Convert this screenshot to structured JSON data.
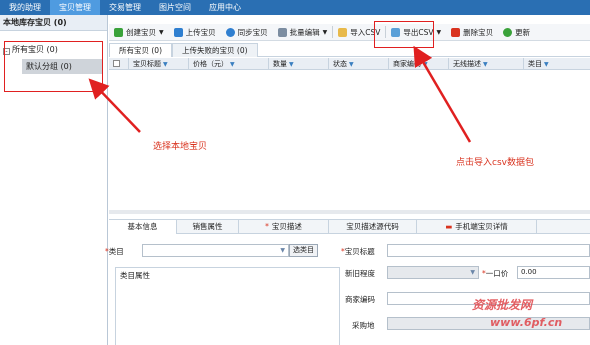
{
  "nav": {
    "tabs": [
      {
        "label": "我的助理"
      },
      {
        "label": "宝贝管理"
      },
      {
        "label": "交易管理"
      },
      {
        "label": "图片空间"
      },
      {
        "label": "应用中心"
      }
    ]
  },
  "left": {
    "title": "本地库存宝贝 (0)",
    "tree_toggle": "-",
    "root_label": "所有宝贝 (0)",
    "child_label": "默认分组 (0)"
  },
  "toolbar": {
    "create": "创建宝贝",
    "upload": "上传宝贝",
    "sync": "同步宝贝",
    "batch_edit": "批量编辑",
    "import_csv": "导入CSV",
    "export_csv": "导出CSV",
    "delete": "删除宝贝",
    "update": "更新"
  },
  "subtabs": {
    "all": "所有宝贝 (0)",
    "failed": "上传失败的宝贝 (0)"
  },
  "grid": {
    "columns": [
      "宝贝标题",
      "价格（元）",
      "数量",
      "状态",
      "商家编码",
      "无线描述",
      "类目"
    ]
  },
  "detail_tabs": {
    "basic": "基本信息",
    "sales": "销售属性",
    "desc": "宝贝描述",
    "desc_code": "宝贝描述源代码",
    "mobile": "手机端宝贝详情"
  },
  "form": {
    "category_label": "类目",
    "select_category_btn": "选类目",
    "category_attr_label": "类目属性",
    "title_label": "宝贝标题",
    "condition_label": "新旧程度",
    "price_label": "一口价",
    "price_value": "0.00",
    "merchant_code_label": "商家编码",
    "purchase_label": "采购地"
  },
  "annotations": {
    "select_local": "选择本地宝贝",
    "import_csv_hint": "点击导入csv数据包"
  },
  "watermark": {
    "line1": "资源批发网",
    "line2": "www.6pf.cn"
  },
  "colors": {
    "nav_bg": "#2a6fb3",
    "nav_active": "#4f9be0",
    "annotation_red": "#d9331f"
  }
}
